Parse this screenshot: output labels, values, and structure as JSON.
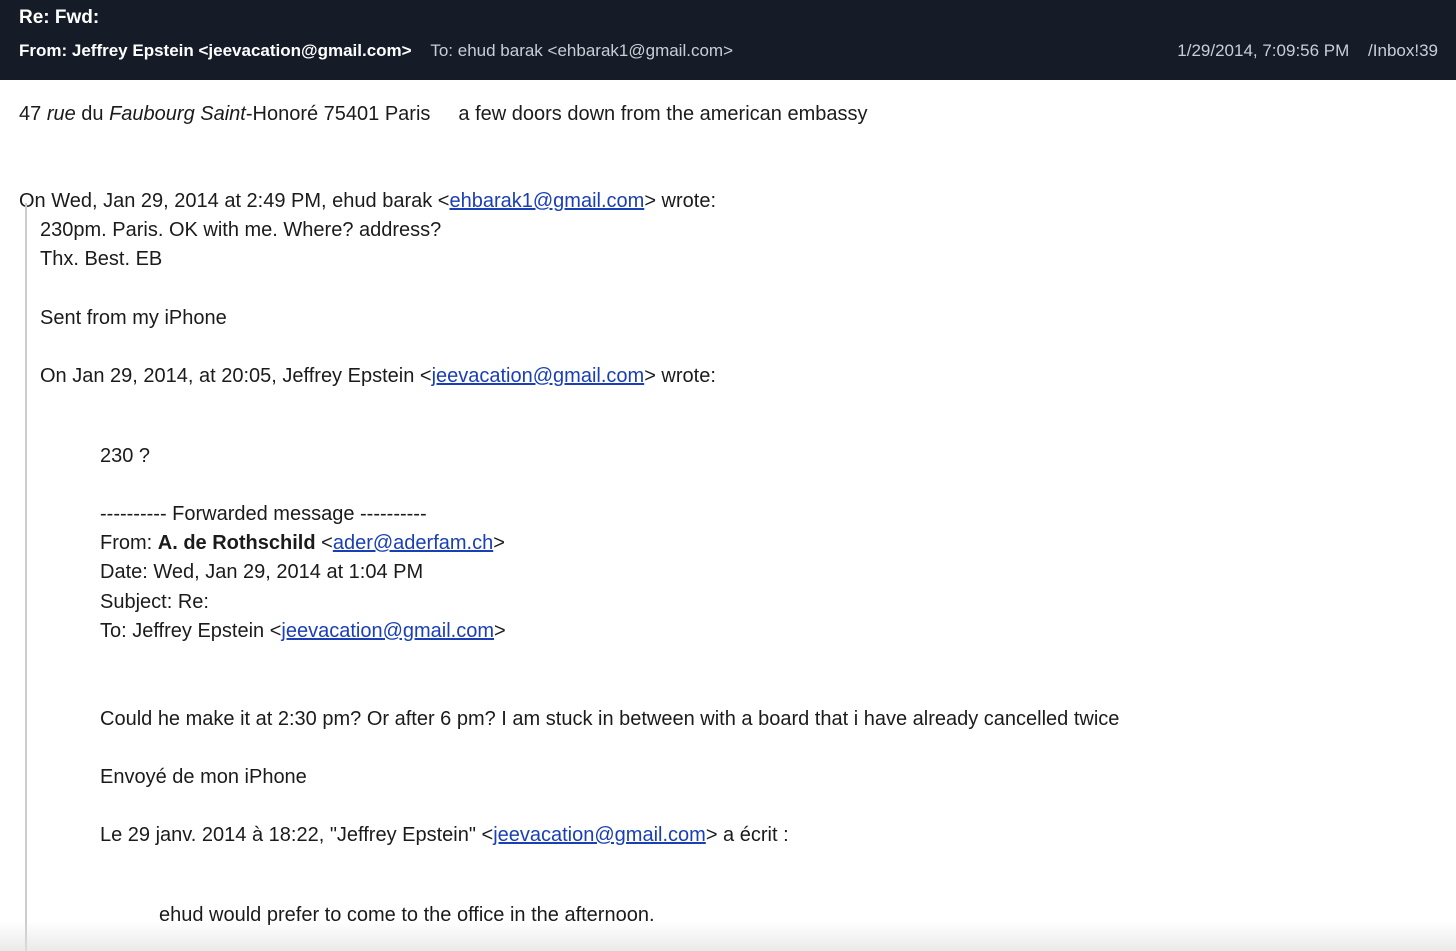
{
  "header": {
    "subject": "Re: Fwd:",
    "from": "From: Jeffrey Epstein <jeevacation@gmail.com>",
    "to": "To: ehud barak <ehbarak1@gmail.com>",
    "date": "1/29/2014, 7:09:56 PM",
    "folder": "/Inbox!39"
  },
  "body": {
    "address": {
      "num": "47 ",
      "rue": "rue",
      "du": " du ",
      "faubourg": "Faubourg Saint",
      "rest": "-Honoré 75401 Paris",
      "note": "a few doors down from the american embassy"
    },
    "q1": {
      "intro_pre": "On Wed, Jan 29, 2014 at 2:49 PM, ehud barak <",
      "intro_email": "ehbarak1@gmail.com",
      "intro_post": "> wrote:",
      "l1": "230pm. Paris. OK with me. Where? address?",
      "l2": "Thx. Best. EB",
      "sent": "Sent from my iPhone",
      "intro2_pre": "On Jan 29, 2014, at 20:05, Jeffrey Epstein <",
      "intro2_email": "jeevacation@gmail.com",
      "intro2_post": "> wrote:"
    },
    "q2": {
      "text": "230 ?",
      "fwd_header": "---------- Forwarded message ----------",
      "from_label": "From: ",
      "from_name": "A. de Rothschild",
      "from_pre": " <",
      "from_email": "ader@aderfam.ch",
      "from_post": ">",
      "date": "Date: Wed, Jan 29, 2014 at 1:04 PM",
      "subject": "Subject: Re:",
      "to_pre": "To: Jeffrey Epstein <",
      "to_email": "jeevacation@gmail.com",
      "to_post": ">",
      "message": "Could he make it at 2:30 pm? Or after 6 pm? I am stuck in between with a board that i have already cancelled twice",
      "envoye": "Envoyé de mon iPhone",
      "le_pre": "Le 29 janv. 2014 à 18:22, \"Jeffrey Epstein\" <",
      "le_email": "jeevacation@gmail.com",
      "le_post": "> a écrit :"
    },
    "q3": {
      "text": "ehud would prefer to come to the office in the afternoon."
    }
  }
}
